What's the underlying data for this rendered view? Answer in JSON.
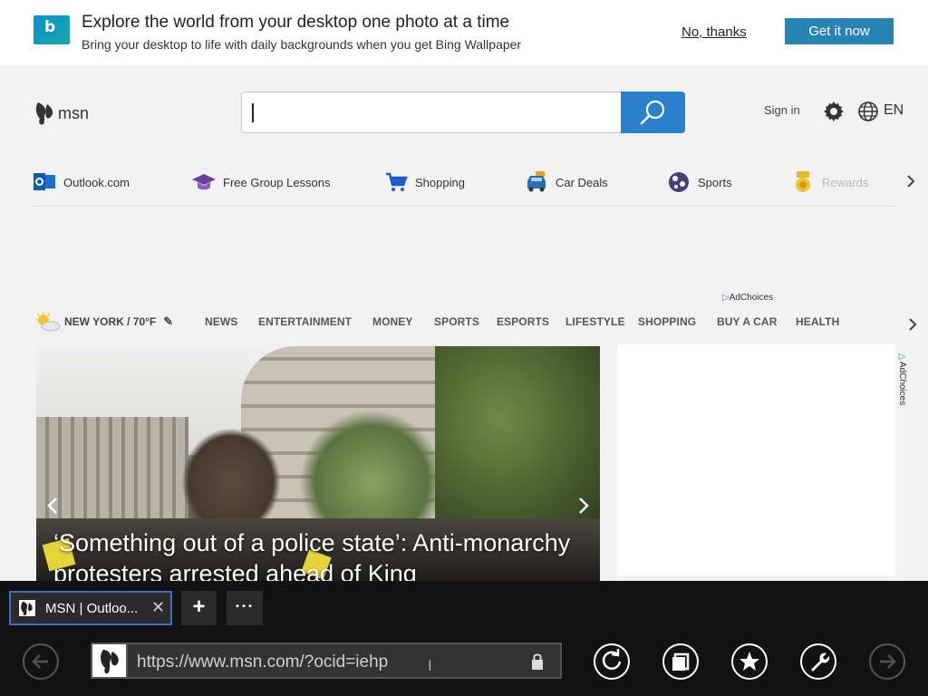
{
  "banner": {
    "title": "Explore the world from your desktop one photo at a time",
    "subtitle": "Bring your desktop to life with daily backgrounds when you get Bing Wallpaper",
    "decline": "No, thanks",
    "accept": "Get it now",
    "logo_icon": "bing-icon"
  },
  "header": {
    "brand": "msn",
    "search_placeholder": "",
    "sign_in": "Sign in",
    "language": "EN"
  },
  "quick_links": [
    {
      "label": "Outlook.com",
      "icon": "outlook-icon"
    },
    {
      "label": "Free Group Lessons",
      "icon": "graduation-cap-icon"
    },
    {
      "label": "Shopping",
      "icon": "shopping-cart-icon"
    },
    {
      "label": "Car Deals",
      "icon": "car-icon"
    },
    {
      "label": "Sports",
      "icon": "soccer-ball-icon"
    },
    {
      "label": "Rewards",
      "icon": "medal-icon"
    }
  ],
  "adchoices": "AdChoices",
  "nav": {
    "weather": "NEW YORK / 70°F",
    "items": [
      "NEWS",
      "ENTERTAINMENT",
      "MONEY",
      "SPORTS",
      "ESPORTS",
      "LIFESTYLE",
      "SHOPPING",
      "BUY A CAR",
      "HEALTH"
    ]
  },
  "hero": {
    "headline": "‘Something out of a police state’: Anti-monarchy protesters arrested ahead of King"
  },
  "ad_side": "AdChoices",
  "browser": {
    "tab_title": "MSN | Outloo...",
    "new_tab": "+",
    "tab_menu": "···",
    "url": "https://www.msn.com/?ocid=iehp",
    "text_cursor": "I"
  }
}
